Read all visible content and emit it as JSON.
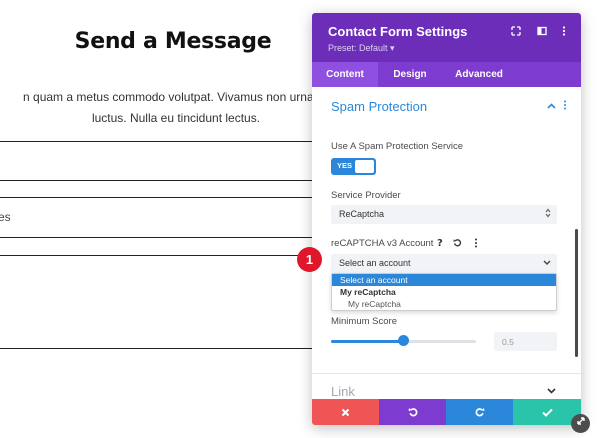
{
  "page": {
    "title": "Send a Message",
    "paragraph_line1": "n quam a metus commodo volutpat. Vivamus non urna sit",
    "paragraph_line2": "luctus. Nulla eu tincidunt lectus.",
    "field_fragment": "es"
  },
  "panel": {
    "title": "Contact Form Settings",
    "preset": "Preset: Default ▾",
    "header_icons": [
      "fullscreen-icon",
      "split-view-icon",
      "more-icon"
    ],
    "tabs": [
      {
        "label": "Content",
        "active": true
      },
      {
        "label": "Design",
        "active": false
      },
      {
        "label": "Advanced",
        "active": false
      }
    ],
    "section": {
      "title": "Spam Protection",
      "use_spam_label": "Use A Spam Protection Service",
      "toggle_text": "YES",
      "provider_label": "Service Provider",
      "provider_value": "ReCaptcha",
      "account_label": "reCAPTCHA v3 Account",
      "account_icons": [
        "help-icon",
        "reset-icon",
        "more-icon"
      ],
      "account_placeholder": "Select an account",
      "dropdown": {
        "selected": "Select an account",
        "group": "My reCaptcha",
        "option": "My reCaptcha"
      },
      "min_score_label": "Minimum Score",
      "min_score_value": "0.5",
      "slider_fraction": 0.5
    },
    "link_section_title": "Link",
    "footer_buttons": [
      "cancel-icon",
      "undo-icon",
      "redo-icon",
      "save-icon"
    ],
    "colors": {
      "header": "#6c2eb9",
      "accent": "#2b87da",
      "cancel": "#ef5555",
      "undo": "#7e3bd0",
      "redo": "#2b87da",
      "save": "#29c4a9"
    }
  },
  "badge": "1"
}
